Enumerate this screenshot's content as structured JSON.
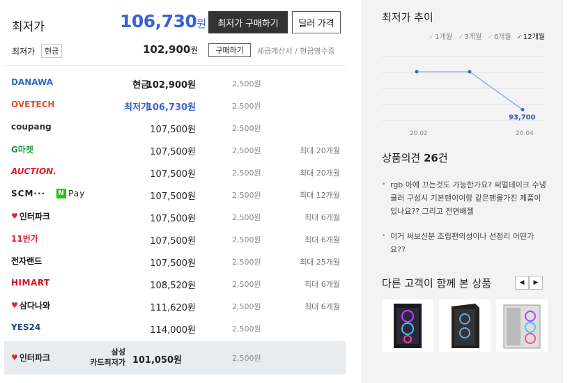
{
  "header": {
    "lowest_label": "최저가",
    "lowest_price": "106,730",
    "won": "원",
    "buy_button": "최저가 구매하기",
    "dealer_button": "딜러 가격",
    "cash_label": "최저가",
    "cash_tag": "현금",
    "cash_price": "102,900",
    "small_buy": "구매하기",
    "tax_note": "세금계산서 / 현금영수증"
  },
  "malls": [
    {
      "logo": "danawa",
      "logo_text": "DANAWA",
      "label": "현금",
      "price": "102,900원",
      "price_style": "bold",
      "ship": "2,500원",
      "inst": ""
    },
    {
      "logo": "ovetech",
      "logo_text": "OVETECH",
      "label": "최저가",
      "price": "106,730원",
      "price_style": "blue",
      "ship": "2,500원",
      "inst": ""
    },
    {
      "logo": "coupang",
      "logo_text": "coupang",
      "label": "",
      "price": "107,500원",
      "price_style": "",
      "ship": "2,500원",
      "inst": ""
    },
    {
      "logo": "gmarket",
      "logo_text": "G마켓",
      "label": "",
      "price": "107,500원",
      "price_style": "",
      "ship": "2,500원",
      "inst": "최대 20개월"
    },
    {
      "logo": "auction",
      "logo_text": "AUCTION.",
      "label": "",
      "price": "107,500원",
      "price_style": "",
      "ship": "2,500원",
      "inst": "최대 20개월"
    },
    {
      "logo": "scm",
      "logo_text": "SCM···",
      "logo_text2": "Pay",
      "label": "",
      "price": "107,500원",
      "price_style": "",
      "ship": "2,500원",
      "inst": "최대 12개월"
    },
    {
      "logo": "interpark",
      "logo_text": "인터파크",
      "label": "",
      "price": "107,500원",
      "price_style": "",
      "ship": "2,500원",
      "inst": "최대 6개월"
    },
    {
      "logo": "11st",
      "logo_text": "11번가",
      "label": "",
      "price": "107,500원",
      "price_style": "",
      "ship": "2,500원",
      "inst": "최대 6개월"
    },
    {
      "logo": "jaje",
      "logo_text": "전자랜드",
      "label": "",
      "price": "107,500원",
      "price_style": "",
      "ship": "2,500원",
      "inst": "최대 25개월"
    },
    {
      "logo": "himart",
      "logo_text": "HIMART",
      "label": "",
      "price": "108,520원",
      "price_style": "",
      "ship": "2,500원",
      "inst": "최대 6개월"
    },
    {
      "logo": "samdanawa",
      "logo_text": "삼다나와",
      "label": "",
      "price": "111,620원",
      "price_style": "",
      "ship": "2,500원",
      "inst": "최대 6개월"
    },
    {
      "logo": "yes24",
      "logo_text": "YES24",
      "label": "",
      "price": "114,000원",
      "price_style": "",
      "ship": "2,500원",
      "inst": ""
    }
  ],
  "card_row": {
    "logo_text": "인터파크",
    "label_line1": "삼성",
    "label_line2": "카드최저가",
    "price": "101,050원",
    "ship": "2,500원"
  },
  "trend": {
    "title": "최저가 추이",
    "tabs": [
      {
        "label": "1개월",
        "active": false
      },
      {
        "label": "3개월",
        "active": false
      },
      {
        "label": "6개월",
        "active": false
      },
      {
        "label": "12개월",
        "active": true
      }
    ],
    "x_labels": [
      "20.02",
      "20.04"
    ],
    "point_label": "93,700",
    "colors": {
      "line": "#7aa0e8",
      "point": "#3862d5"
    }
  },
  "chart_data": {
    "type": "line",
    "x": [
      "20.02",
      "20.03",
      "20.04"
    ],
    "series": [
      {
        "values": [
          106730,
          106730,
          93700
        ]
      }
    ],
    "data_labels": [
      "",
      "",
      "93,700"
    ],
    "ylim": [
      90000,
      112000
    ],
    "grid": true
  },
  "opinions": {
    "title": "상품의견",
    "count": "26",
    "unit": "건",
    "items": [
      "rgb 아예 끄는것도 가능한가요? 써멀테이크 수냉쿨러 구성시 기본팬이이랑 같은팬을가진 제품이 있나요?? 그리고 전면배젤",
      "이거 써보신분 조립편의성이나 선정리 어떤가요??"
    ]
  },
  "also_viewed": {
    "title": "다른 고객이 함께 본 상품",
    "prev": "◀",
    "next": "▶"
  }
}
